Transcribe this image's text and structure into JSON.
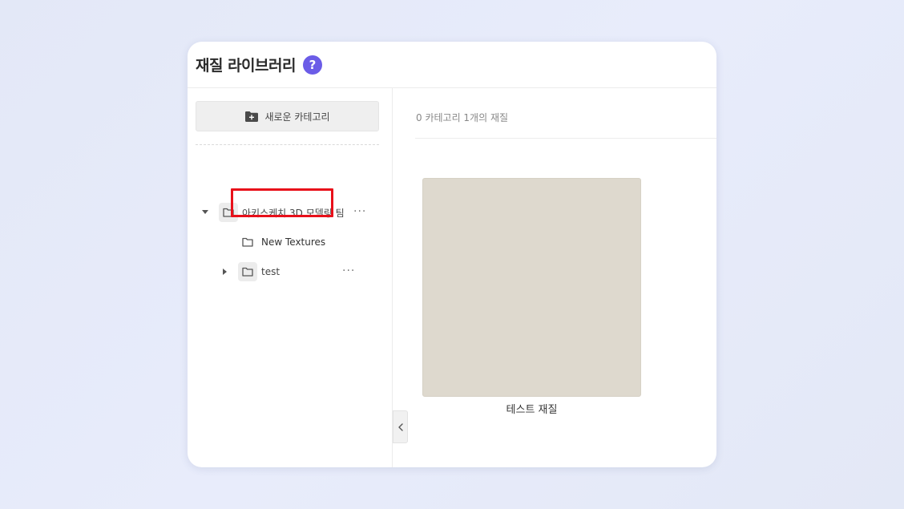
{
  "header": {
    "title": "재질 라이브러리",
    "help_label": "?"
  },
  "sidebar": {
    "new_category_label": "새로운 카테고리",
    "tree": {
      "root": {
        "label": "아키스케치 3D 모델링 팀",
        "expanded": true,
        "more": "···"
      },
      "children": [
        {
          "label": "New Textures",
          "selected": true
        },
        {
          "label": "test",
          "expanded": false,
          "more": "···"
        }
      ]
    }
  },
  "main": {
    "summary": "0 카테고리 1개의 재질",
    "materials": [
      {
        "name": "테스트 재질",
        "color": "#ded9ce"
      }
    ]
  },
  "colors": {
    "accent": "#6b5ce7",
    "highlight": "#e8101a"
  }
}
